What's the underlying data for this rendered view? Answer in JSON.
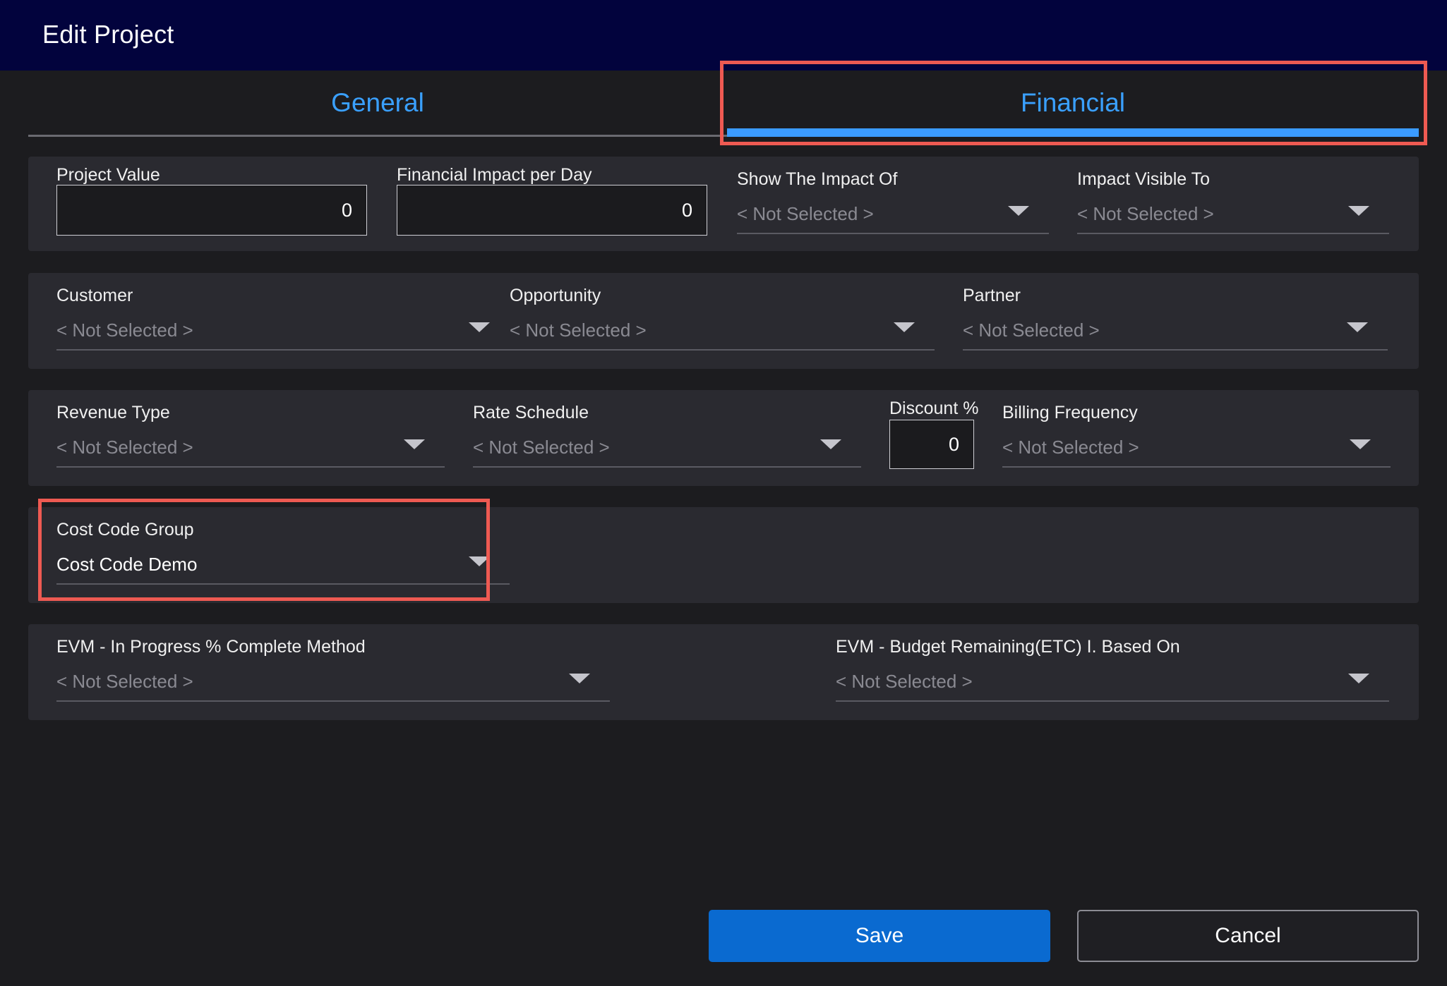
{
  "dialog": {
    "title": "Edit Project"
  },
  "tabs": [
    {
      "label": "General",
      "active": false
    },
    {
      "label": "Financial",
      "active": true
    }
  ],
  "row1": {
    "project_value": {
      "label": "Project Value",
      "value": "0"
    },
    "financial_impact": {
      "label": "Financial Impact per Day",
      "value": "0"
    },
    "show_impact_of": {
      "label": "Show The Impact Of",
      "value": "< Not Selected >"
    },
    "impact_visible_to": {
      "label": "Impact Visible To",
      "value": "< Not Selected >"
    }
  },
  "row2": {
    "customer": {
      "label": "Customer",
      "value": "< Not Selected >"
    },
    "opportunity": {
      "label": "Opportunity",
      "value": "< Not Selected >"
    },
    "partner": {
      "label": "Partner",
      "value": "< Not Selected >"
    }
  },
  "row3": {
    "revenue_type": {
      "label": "Revenue Type",
      "value": "< Not Selected >"
    },
    "rate_schedule": {
      "label": "Rate Schedule",
      "value": "< Not Selected >"
    },
    "discount": {
      "label": "Discount %",
      "value": "0"
    },
    "billing_frequency": {
      "label": "Billing Frequency",
      "value": "< Not Selected >"
    }
  },
  "row4": {
    "cost_code_group": {
      "label": "Cost Code Group",
      "value": "Cost Code Demo"
    }
  },
  "row5": {
    "evm_complete_method": {
      "label": "EVM - In Progress % Complete Method",
      "value": "< Not Selected >"
    },
    "evm_budget_remaining": {
      "label": "EVM - Budget Remaining(ETC) I. Based On",
      "value": "< Not Selected >"
    }
  },
  "buttons": {
    "save": "Save",
    "cancel": "Cancel"
  },
  "colors": {
    "titlebar": "#02033d",
    "accent": "#3b9bff",
    "highlight": "#ee5a52",
    "save": "#0a6ad0"
  }
}
